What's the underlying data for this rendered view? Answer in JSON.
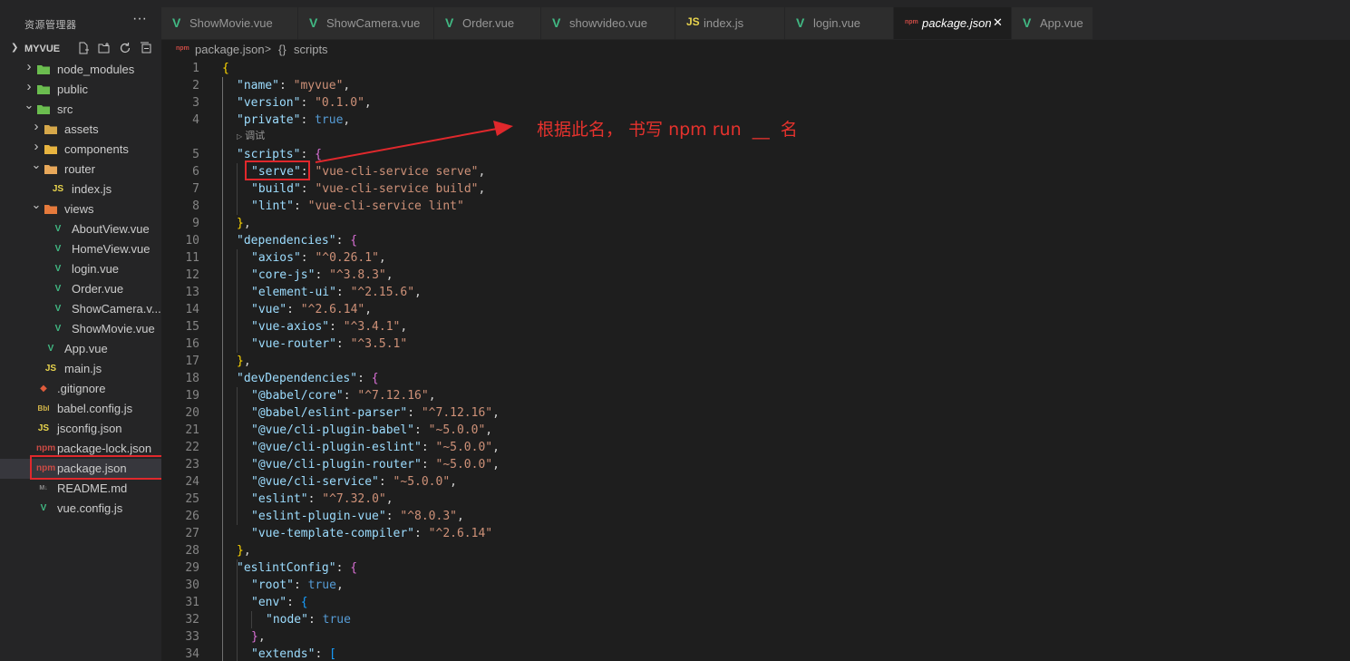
{
  "sidebar": {
    "title": "资源管理器",
    "more_label": "···",
    "project": "MYVUE",
    "tree": [
      {
        "label": "node_modules",
        "icon": "folder-icon",
        "depth": 0,
        "folder": true,
        "open": false
      },
      {
        "label": "public",
        "icon": "folder-icon",
        "depth": 0,
        "folder": true,
        "open": false
      },
      {
        "label": "src",
        "icon": "folder-icon",
        "depth": 0,
        "folder": true,
        "open": true
      },
      {
        "label": "assets",
        "icon": "folder-icon",
        "depth": 1,
        "folder": true,
        "open": false
      },
      {
        "label": "components",
        "icon": "folder-icon",
        "depth": 1,
        "folder": true,
        "open": false
      },
      {
        "label": "router",
        "icon": "folder-icon",
        "depth": 1,
        "folder": true,
        "open": true
      },
      {
        "label": "index.js",
        "icon": "js-file-icon",
        "depth": 2,
        "folder": false
      },
      {
        "label": "views",
        "icon": "folder-icon",
        "depth": 1,
        "folder": true,
        "open": true
      },
      {
        "label": "AboutView.vue",
        "icon": "vue-file-icon",
        "depth": 2,
        "folder": false
      },
      {
        "label": "HomeView.vue",
        "icon": "vue-file-icon",
        "depth": 2,
        "folder": false
      },
      {
        "label": "login.vue",
        "icon": "vue-file-icon",
        "depth": 2,
        "folder": false
      },
      {
        "label": "Order.vue",
        "icon": "vue-file-icon",
        "depth": 2,
        "folder": false
      },
      {
        "label": "ShowCamera.v...",
        "icon": "vue-file-icon",
        "depth": 2,
        "folder": false
      },
      {
        "label": "ShowMovie.vue",
        "icon": "vue-file-icon",
        "depth": 2,
        "folder": false
      },
      {
        "label": "App.vue",
        "icon": "vue-file-icon",
        "depth": 1,
        "folder": false
      },
      {
        "label": "main.js",
        "icon": "js-file-icon",
        "depth": 1,
        "folder": false
      },
      {
        "label": ".gitignore",
        "icon": "git-file-icon",
        "depth": 0,
        "folder": false
      },
      {
        "label": "babel.config.js",
        "icon": "babel-file-icon",
        "depth": 0,
        "folder": false
      },
      {
        "label": "jsconfig.json",
        "icon": "js-file-icon",
        "depth": 0,
        "folder": false
      },
      {
        "label": "package-lock.json",
        "icon": "npm-file-icon",
        "depth": 0,
        "folder": false
      },
      {
        "label": "package.json",
        "icon": "npm-file-icon",
        "depth": 0,
        "folder": false,
        "selected": true
      },
      {
        "label": "README.md",
        "icon": "markdown-file-icon",
        "depth": 0,
        "folder": false
      },
      {
        "label": "vue.config.js",
        "icon": "vue-file-icon",
        "depth": 0,
        "folder": false
      }
    ]
  },
  "tabs": [
    {
      "label": "ShowMovie.vue",
      "icon": "vue-file-icon"
    },
    {
      "label": "ShowCamera.vue",
      "icon": "vue-file-icon"
    },
    {
      "label": "Order.vue",
      "icon": "vue-file-icon"
    },
    {
      "label": "showvideo.vue",
      "icon": "vue-file-icon"
    },
    {
      "label": "index.js",
      "icon": "js-file-icon"
    },
    {
      "label": "login.vue",
      "icon": "vue-file-icon"
    },
    {
      "label": "package.json",
      "icon": "npm-file-icon",
      "active": true
    },
    {
      "label": "App.vue",
      "icon": "vue-file-icon"
    }
  ],
  "tab_close_glyph": "✕",
  "breadcrumb": {
    "file": "package.json",
    "separator": ">",
    "braces": "{}",
    "symbol": "scripts"
  },
  "codelens": "调试",
  "code_lines": [
    "{",
    "\"name\": \"myvue\",",
    "\"version\": \"0.1.0\",",
    "\"private\": true,",
    "\"scripts\": {",
    "\"serve\": \"vue-cli-service serve\",",
    "\"build\": \"vue-cli-service build\",",
    "\"lint\": \"vue-cli-service lint\"",
    "},",
    "\"dependencies\": {",
    "\"axios\": \"^0.26.1\",",
    "\"core-js\": \"^3.8.3\",",
    "\"element-ui\": \"^2.15.6\",",
    "\"vue\": \"^2.6.14\",",
    "\"vue-axios\": \"^3.4.1\",",
    "\"vue-router\": \"^3.5.1\"",
    "},",
    "\"devDependencies\": {",
    "\"@babel/core\": \"^7.12.16\",",
    "\"@babel/eslint-parser\": \"^7.12.16\",",
    "\"@vue/cli-plugin-babel\": \"~5.0.0\",",
    "\"@vue/cli-plugin-eslint\": \"~5.0.0\",",
    "\"@vue/cli-plugin-router\": \"~5.0.0\",",
    "\"@vue/cli-service\": \"~5.0.0\",",
    "\"eslint\": \"^7.32.0\",",
    "\"eslint-plugin-vue\": \"^8.0.3\",",
    "\"vue-template-compiler\": \"^2.6.14\"",
    "},",
    "\"eslintConfig\": {",
    "\"root\": true,",
    "\"env\": {",
    "\"node\": true",
    "},",
    "\"extends\": ["
  ],
  "annotation": "根据此名， 书写 npm run  __  名",
  "colors": {
    "sidebar_bg": "#252526",
    "editor_bg": "#1e1e1e",
    "annotation_red": "#e0282c",
    "json_key": "#9cdcfe",
    "json_string": "#ce9178",
    "json_bool": "#569cd6"
  }
}
